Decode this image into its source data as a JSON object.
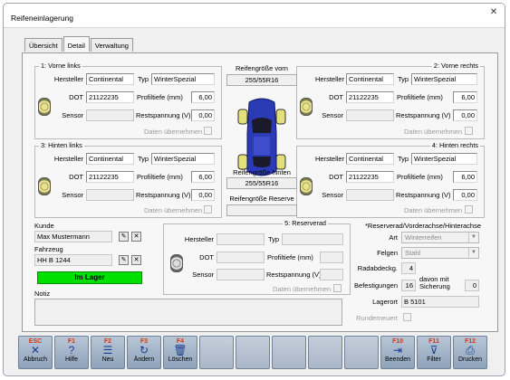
{
  "window": {
    "title": "Reifeneinlagerung"
  },
  "tabs": [
    {
      "label": "Übersicht"
    },
    {
      "label": "Detail"
    },
    {
      "label": "Verwaltung"
    }
  ],
  "labels": {
    "hersteller": "Hersteller",
    "typ": "Typ",
    "dot": "DOT",
    "profiltiefe": "Profiltiefe (mm)",
    "sensor": "Sensor",
    "restspannung": "Restspannung (V)",
    "daten_uebernehmen": "Daten übernehmen",
    "kunde": "Kunde",
    "fahrzeug": "Fahrzeug",
    "notiz": "Notiz",
    "art": "Art",
    "felgen": "Felgen",
    "radabdeckg": "Radabdeckg.",
    "befestigungen": "Befestigungen",
    "davon_mit_sicherung": "davon mit Sicherung",
    "lagerort": "Lagerort",
    "runderneuert": "Runderneuert"
  },
  "wheels": {
    "front_left": {
      "title": "1: Vorne links",
      "hersteller": "Continental",
      "typ": "WinterSpezial",
      "dot": "21122235",
      "profiltiefe": "6,00",
      "sensor": "",
      "restspannung": "0,00"
    },
    "front_right": {
      "title": "2: Vorne rechts",
      "hersteller": "Continental",
      "typ": "WinterSpezial",
      "dot": "21122235",
      "profiltiefe": "6,00",
      "sensor": "",
      "restspannung": "0,00"
    },
    "rear_left": {
      "title": "3: Hinten links",
      "hersteller": "Continental",
      "typ": "WinterSpezial",
      "dot": "21122235",
      "profiltiefe": "6,00",
      "sensor": "",
      "restspannung": "0,00"
    },
    "rear_right": {
      "title": "4: Hinten rechts",
      "hersteller": "Continental",
      "typ": "WinterSpezial",
      "dot": "21122235",
      "profiltiefe": "6,00",
      "sensor": "",
      "restspannung": "0,00"
    },
    "reserve": {
      "title": "5: Reserverad",
      "hersteller": "",
      "typ": "",
      "dot": "",
      "profiltiefe": "",
      "sensor": "",
      "restspannung": ""
    }
  },
  "center": {
    "front_size_label": "Reifengröße vorn",
    "front_size": "255/55R16",
    "rear_size_label": "Reifengröße hinten",
    "rear_size": "255/55R16",
    "reserve_size_label": "Reifengröße Reserve"
  },
  "customer": {
    "name": "Max Mustermann",
    "vehicle": "HH B 1244",
    "status": "Im Lager",
    "status_color": "#00e000"
  },
  "right_panel": {
    "header": "*Reserverad/Vorderachse/Hinterachse",
    "art": "Winterreifen",
    "felgen": "Stahl",
    "radabdeckg": "4",
    "befestigungen": "16",
    "davon_mit_sicherung": "0",
    "lagerort": "B 5101"
  },
  "fkeys": [
    {
      "key": "ESC",
      "icon": "close-icon",
      "label": "Abbruch"
    },
    {
      "key": "F1",
      "icon": "help-icon",
      "label": "Hilfe"
    },
    {
      "key": "F2",
      "icon": "new-icon",
      "label": "Neu"
    },
    {
      "key": "F3",
      "icon": "refresh-icon",
      "label": "Ändern"
    },
    {
      "key": "F4",
      "icon": "trash-icon",
      "label": "Löschen"
    },
    {
      "key": "F10",
      "icon": "exit-icon",
      "label": "Beenden"
    },
    {
      "key": "F11",
      "icon": "filter-icon",
      "label": "Filter"
    },
    {
      "key": "F12",
      "icon": "print-icon",
      "label": "Drucken"
    }
  ],
  "colors": {
    "accent": "#1a3d8c",
    "fkey_label": "#d6370a",
    "status_green": "#00e000"
  }
}
